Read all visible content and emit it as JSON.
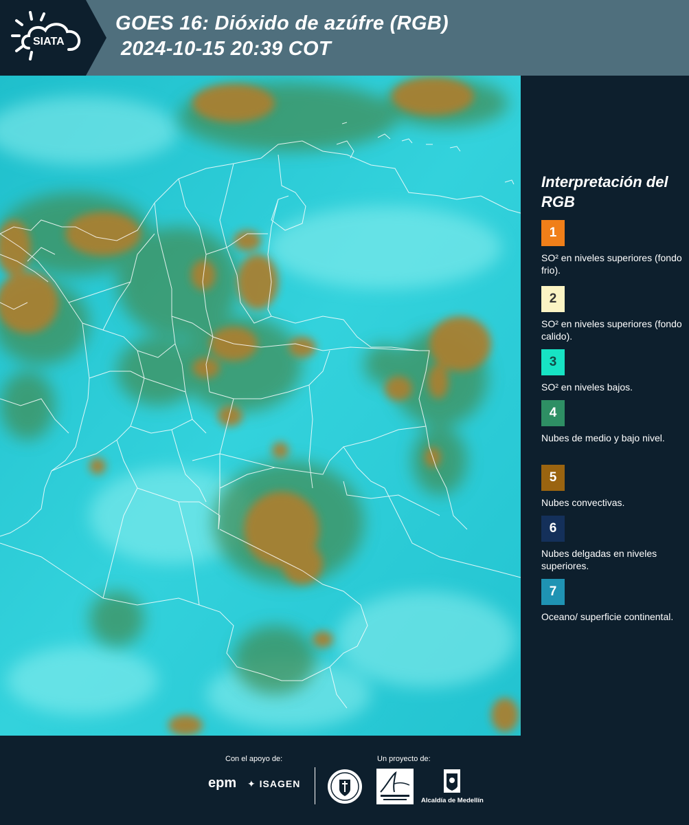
{
  "header": {
    "logo_text": "SIATA",
    "title_line1": "GOES 16: Dióxido de azúfre (RGB)",
    "title_line2": "2024-10-15 20:39 COT"
  },
  "legend": {
    "title": "Interpretación del RGB",
    "items": [
      {
        "number": "1",
        "text": "SO² en niveles superiores (fondo frio).",
        "color": "#f07f19"
      },
      {
        "number": "2",
        "text": "SO² en niveles superiores (fondo calido).",
        "color": "#fbf4c4"
      },
      {
        "number": "3",
        "text": "SO² en niveles bajos.",
        "color": "#17e3c4"
      },
      {
        "number": "4",
        "text": "Nubes de medio y bajo nivel.",
        "color": "#2e8f64"
      },
      {
        "number": "5",
        "text": "Nubes convectivas.",
        "color": "#9a6410"
      },
      {
        "number": "6",
        "text": "Nubes delgadas en niveles superiores.",
        "color": "#14305a"
      },
      {
        "number": "7",
        "text": "Oceano/ superficie continental.",
        "color": "#1f93b3"
      }
    ]
  },
  "footer": {
    "support_label": "Con el apoyo de:",
    "project_label": "Un proyecto de:",
    "epm_logo": "epm",
    "isagen_logo": "ISAGEN",
    "area_logo": "Área Metropolitana Valle de Aburrá",
    "alcaldia_logo": "Alcaldía de Medellín",
    "medellin_seal": "Medellín"
  },
  "colors": {
    "background": "#0d1f2d",
    "header_band": "#4f6f7d",
    "map_base": "#2fc9d6",
    "cloud_convective": "#a88030",
    "cloud_mid_low": "#3f8f5a",
    "boundaries": "#ffffff"
  }
}
